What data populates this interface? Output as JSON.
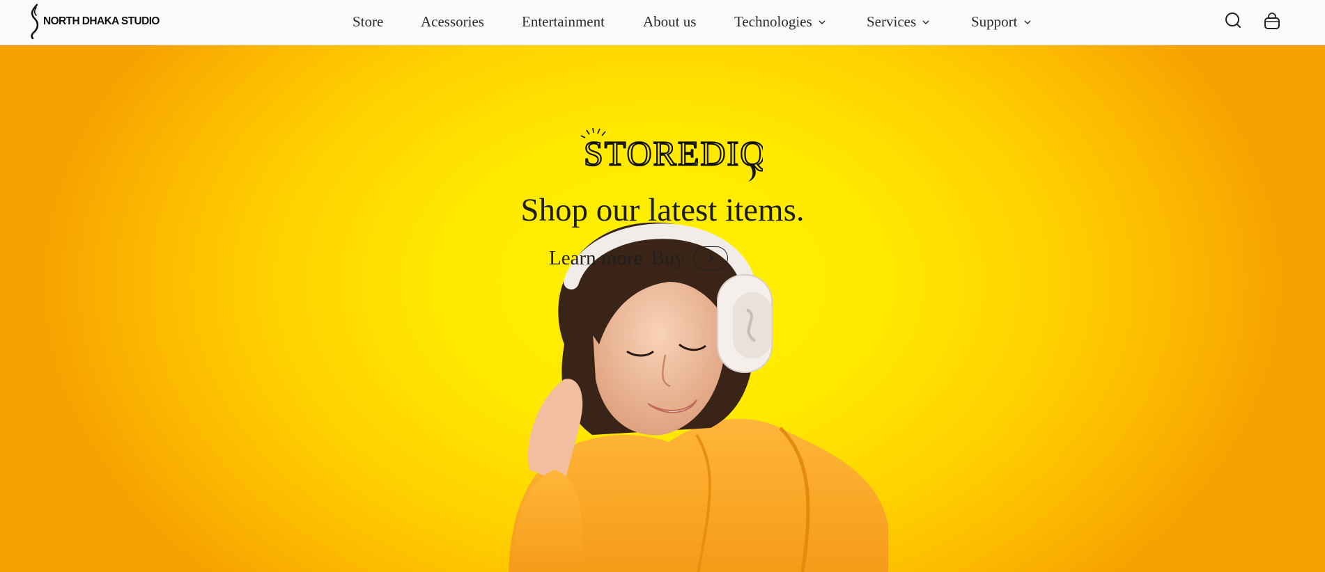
{
  "header": {
    "logo_text": "NORTH DHAKA STUDIO",
    "nav": [
      {
        "label": "Store"
      },
      {
        "label": "Acessories"
      },
      {
        "label": "Entertainment"
      },
      {
        "label": "About us"
      },
      {
        "label": "Technologies",
        "has_dropdown": true
      },
      {
        "label": "Services",
        "has_dropdown": true
      },
      {
        "label": "Support",
        "has_dropdown": true
      }
    ],
    "icons": [
      "search-icon",
      "bag-icon"
    ]
  },
  "hero": {
    "brand_art_text": "STOREDIQ",
    "headline": "Shop our latest items.",
    "cta_primary": "Learn more",
    "cta_secondary": "Buy",
    "colors": {
      "center": "#fff200",
      "edge": "#f6a100",
      "hoodie": "#ffad2e"
    }
  }
}
